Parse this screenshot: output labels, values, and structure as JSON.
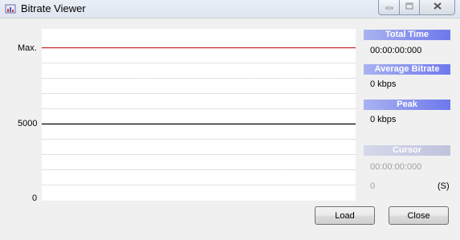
{
  "window": {
    "title": "Bitrate Viewer",
    "icon": "bitrate-app-icon"
  },
  "chart": {
    "y_labels": {
      "max": "Max.",
      "mid": "5000",
      "zero": "0"
    }
  },
  "stats": {
    "total_time": {
      "label": "Total Time",
      "value": "00:00:00:000"
    },
    "average_bitrate": {
      "label": "Average Bitrate",
      "value": "0 kbps"
    },
    "peak": {
      "label": "Peak",
      "value": "0 kbps"
    },
    "cursor": {
      "label": "Cursor",
      "time": "00:00:00:000",
      "value": "0",
      "unit": "(S)"
    }
  },
  "buttons": {
    "load": "Load",
    "close": "Close"
  },
  "colors": {
    "max_line": "#c0282e",
    "mid_line": "#000000",
    "header_active": "#6e78ec",
    "header_disabled": "#bfc3dc"
  }
}
